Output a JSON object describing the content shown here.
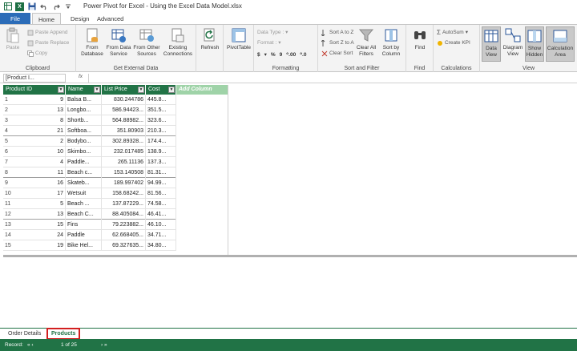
{
  "title_bar": {
    "title": "Power Pivot for Excel - Using the Excel Data Model.xlsx",
    "app_badge": "X"
  },
  "tabs": [
    {
      "label": "File"
    },
    {
      "label": "Home"
    },
    {
      "label": "Design"
    },
    {
      "label": "Advanced"
    }
  ],
  "ribbon": {
    "clipboard": {
      "group_label": "Clipboard",
      "paste": "Paste",
      "paste_append": "Paste Append",
      "paste_replace": "Paste Replace",
      "copy": "Copy"
    },
    "external": {
      "group_label": "Get External Data",
      "from_database": "From Database",
      "from_data_service": "From Data Service",
      "from_other_sources": "From Other Sources",
      "existing_connections": "Existing Connections"
    },
    "refresh": {
      "label": "Refresh"
    },
    "pivottable": {
      "label": "PivotTable"
    },
    "formatting": {
      "group_label": "Formatting",
      "data_type": "Data Type :",
      "format": "Format :",
      "currency": "$",
      "percent": "%",
      "comma": "9",
      "inc_decimal": "⁰.00",
      "dec_decimal": "⁰.0"
    },
    "sort": {
      "group_label": "Sort and Filter",
      "sort_a_z": "Sort A to Z",
      "sort_z_a": "Sort Z to A",
      "clear_sort": "Clear Sort",
      "clear_all_filters": "Clear All Filters",
      "sort_by_column": "Sort by Column"
    },
    "find": {
      "group_label": "Find",
      "label": "Find"
    },
    "calculations": {
      "group_label": "Calculations",
      "autosum": "AutoSum",
      "create_kpi": "Create KPI"
    },
    "view": {
      "group_label": "View",
      "data_view": "Data View",
      "diagram_view": "Diagram View",
      "show_hidden": "Show Hidden",
      "calculation_area": "Calculation Area"
    }
  },
  "formula_bar": {
    "name_box": "[Product I...",
    "fx": "fx"
  },
  "table": {
    "columns": [
      "Product ID",
      "Name",
      "List Price",
      "Cost"
    ],
    "add_column": "Add Column",
    "rows": [
      {
        "n": "1",
        "id": "9",
        "name": "Balsa B...",
        "price": "830.244786",
        "cost": "445.8..."
      },
      {
        "n": "2",
        "id": "13",
        "name": "Longbo...",
        "price": "586.94423...",
        "cost": "351.5..."
      },
      {
        "n": "3",
        "id": "8",
        "name": "Shortb...",
        "price": "564.88982...",
        "cost": "323.6..."
      },
      {
        "n": "4",
        "id": "21",
        "name": "Softboa...",
        "price": "351.80903",
        "cost": "210.3..."
      },
      {
        "n": "5",
        "id": "2",
        "name": "Bodybo...",
        "price": "302.89328...",
        "cost": "174.4..."
      },
      {
        "n": "6",
        "id": "10",
        "name": "Skimbo...",
        "price": "232.017485",
        "cost": "138.9..."
      },
      {
        "n": "7",
        "id": "4",
        "name": "Paddle...",
        "price": "265.11136",
        "cost": "137.3..."
      },
      {
        "n": "8",
        "id": "11",
        "name": "Beach c...",
        "price": "153.140508",
        "cost": "81.31..."
      },
      {
        "n": "9",
        "id": "16",
        "name": "Skateb...",
        "price": "189.997402",
        "cost": "94.99..."
      },
      {
        "n": "10",
        "id": "17",
        "name": "Wetsuit",
        "price": "158.68242...",
        "cost": "81.56..."
      },
      {
        "n": "11",
        "id": "5",
        "name": "Beach ...",
        "price": "137.87229...",
        "cost": "74.58..."
      },
      {
        "n": "12",
        "id": "13",
        "name": "Beach C...",
        "price": "88.405084...",
        "cost": "46.41..."
      },
      {
        "n": "13",
        "id": "15",
        "name": "Fins",
        "price": "79.223882...",
        "cost": "46.10..."
      },
      {
        "n": "14",
        "id": "24",
        "name": "Paddle",
        "price": "62.668405...",
        "cost": "34.71..."
      },
      {
        "n": "15",
        "id": "19",
        "name": "Bike Hel...",
        "price": "69.327635...",
        "cost": "34.80..."
      }
    ]
  },
  "sheet_tabs": [
    {
      "label": "Order Details"
    },
    {
      "label": "Products"
    }
  ],
  "status_bar": {
    "record_label": "Record:",
    "nav_first": "« ‹",
    "record_position": "1 of 25",
    "nav_last": "› »"
  },
  "colors": {
    "accent_green": "#217346",
    "file_tab_blue": "#2b6cb8",
    "highlight_red": "#d21f1f",
    "add_column_green": "#9fd3a8"
  }
}
